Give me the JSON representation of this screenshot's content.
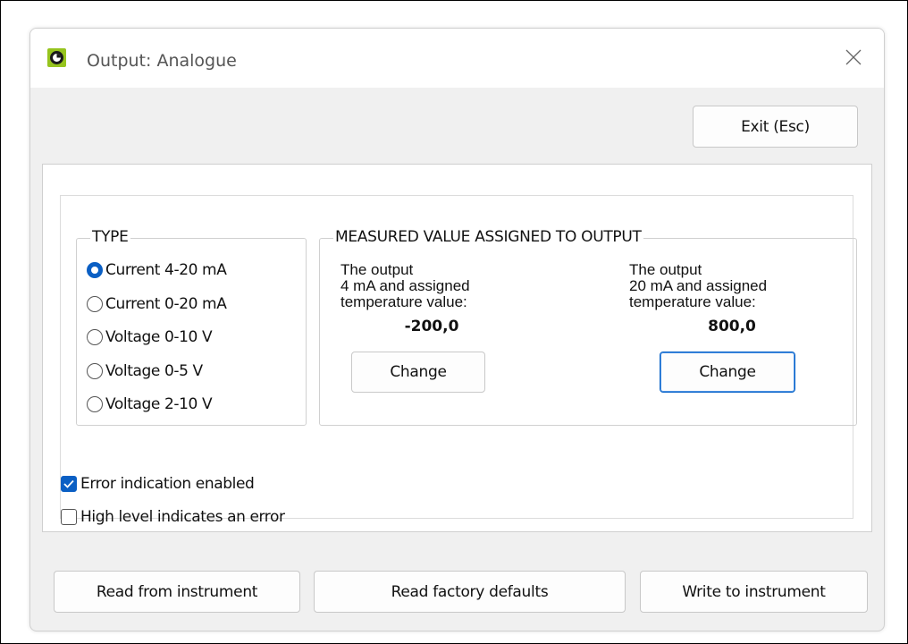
{
  "window": {
    "title": "Output: Analogue"
  },
  "toolbar": {
    "exit_label": "Exit (Esc)"
  },
  "type_group": {
    "legend": "TYPE",
    "options": [
      {
        "label": "Current 4-20 mA",
        "checked": true
      },
      {
        "label": "Current 0-20 mA",
        "checked": false
      },
      {
        "label": "Voltage 0-10 V",
        "checked": false
      },
      {
        "label": "Voltage 0-5 V",
        "checked": false
      },
      {
        "label": "Voltage 2-10 V",
        "checked": false
      }
    ]
  },
  "measured_group": {
    "legend": "MEASURED VALUE ASSIGNED TO OUTPUT",
    "low": {
      "line1": "The output",
      "line2": "4 mA and assigned",
      "line3": "temperature value:",
      "value": "-200,0",
      "change_label": "Change"
    },
    "high": {
      "line1": "The output",
      "line2": "20 mA and assigned",
      "line3": "temperature value:",
      "value": "800,0",
      "change_label": "Change"
    }
  },
  "options": {
    "error_indication": {
      "label": "Error indication enabled",
      "checked": true
    },
    "high_level": {
      "label": "High level indicates an error",
      "checked": false
    }
  },
  "footer": {
    "read_instrument": "Read from instrument",
    "read_defaults": "Read factory defaults",
    "write_instrument": "Write to instrument"
  },
  "colors": {
    "accent": "#0a5fc4",
    "app_icon": "#96c41e"
  }
}
